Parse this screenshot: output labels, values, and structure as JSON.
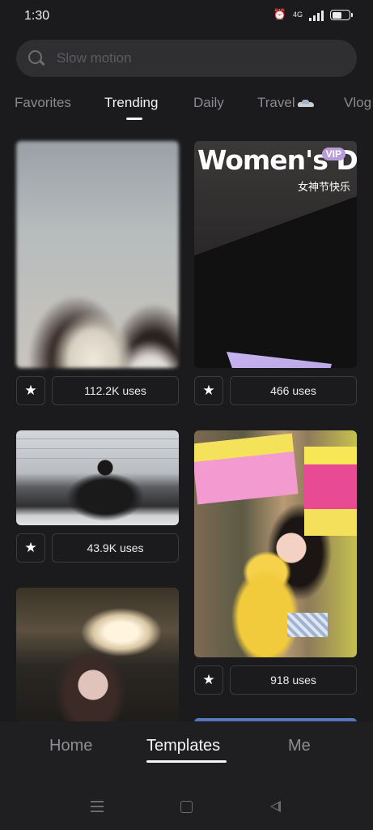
{
  "status_bar": {
    "time": "1:30",
    "network_label": "4G",
    "icons": [
      "alarm-off-icon",
      "signal-icon",
      "battery-icon"
    ]
  },
  "search": {
    "placeholder": "Slow motion",
    "value": ""
  },
  "tabs": [
    {
      "label": "Favorites",
      "active": false
    },
    {
      "label": "Trending",
      "active": true
    },
    {
      "label": "Daily",
      "active": false
    },
    {
      "label": "Travel",
      "active": false,
      "icon": "car-icon"
    },
    {
      "label": "Vlog",
      "active": false
    }
  ],
  "templates": [
    {
      "uses": "112.2K uses",
      "thumb": "two girls selfie (blurred)"
    },
    {
      "uses": "466 uses",
      "thumb": "bouquet",
      "overlay_title": "Women's Day",
      "overlay_badge": "VIP",
      "overlay_subtitle": "女神节快乐"
    },
    {
      "uses": "43.9K uses",
      "thumb": "office"
    },
    {
      "uses": "918 uses",
      "thumb": "girl with yellow toy"
    },
    {
      "uses": "",
      "thumb": "cafe"
    }
  ],
  "bottom_nav": {
    "items": [
      {
        "label": "Home",
        "active": false
      },
      {
        "label": "Templates",
        "active": true
      },
      {
        "label": "Me",
        "active": false
      }
    ]
  },
  "colors": {
    "background": "#1b1b1d",
    "search_bg": "#2f2f32",
    "active_text": "#f4f4f4",
    "inactive_text": "#8a8a8e"
  }
}
